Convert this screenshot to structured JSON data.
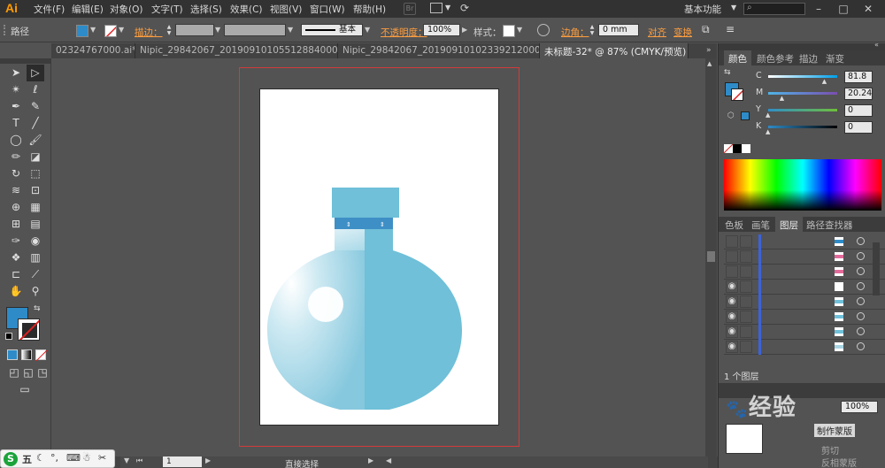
{
  "app": {
    "logo": "Ai"
  },
  "menu": {
    "items": [
      "文件(F)",
      "编辑(E)",
      "对象(O)",
      "文字(T)",
      "选择(S)",
      "效果(C)",
      "视图(V)",
      "窗口(W)",
      "帮助(H)"
    ],
    "br_label": "Br",
    "workspace": "基本功能"
  },
  "control": {
    "object_type": "路径",
    "stroke_label": "描边：",
    "stroke_style": "基本",
    "opacity_label": "不透明度：",
    "opacity_value": "100%",
    "style_label": "样式：",
    "corner_label": "边角：",
    "corner_value": "0 mm",
    "align_label": "对齐",
    "transform_label": "变换",
    "fill_color": "#2e8bc7"
  },
  "tabs": [
    {
      "label": "02324767000.ai*",
      "active": false
    },
    {
      "label": "Nipic_29842067_20190910105512884000.ai*",
      "active": false
    },
    {
      "label": "Nipic_29842067_20190910102339212000.ai*",
      "active": false
    },
    {
      "label": "未标题-32* @ 87% (CMYK/预览)",
      "active": true
    }
  ],
  "color_panel": {
    "tabs": [
      "颜色",
      "颜色参考",
      "描边",
      "渐变"
    ],
    "channels": [
      {
        "letter": "C",
        "value": "81.8",
        "percent": 81.8,
        "gradient": "linear-gradient(to right,#ffffff,#00a0e9)"
      },
      {
        "letter": "M",
        "value": "20.24",
        "percent": 20.24,
        "gradient": "linear-gradient(to right,#4fb3e6,#7a4fb0)"
      },
      {
        "letter": "Y",
        "value": "0",
        "percent": 0,
        "gradient": "linear-gradient(to right,#2f8fc8,#6fbf3b)"
      },
      {
        "letter": "K",
        "value": "0",
        "percent": 0,
        "gradient": "linear-gradient(to right,#2e8bc7,#000000)"
      }
    ],
    "swatch_color": "#2e8bc7"
  },
  "layers_panel": {
    "tabs": [
      "色板",
      "画笔",
      "图层",
      "路径查找器"
    ],
    "active_tab": "图层",
    "footer": "1 个图层",
    "rows": [
      {
        "visible": false,
        "thumb": "#2e8bc7"
      },
      {
        "visible": false,
        "thumb": "#e26a9a"
      },
      {
        "visible": false,
        "thumb": "#e26a9a"
      },
      {
        "visible": true,
        "thumb": "#ffffff"
      },
      {
        "visible": true,
        "thumb": "#6fc0d8"
      },
      {
        "visible": true,
        "thumb": "#6fc0d8"
      },
      {
        "visible": true,
        "thumb": "#6fc0d8"
      },
      {
        "visible": true,
        "thumb": "#a8d4e3"
      }
    ]
  },
  "transparency": {
    "value": "100%",
    "mask_label": "制作蒙版",
    "clip_label": "剪切",
    "invert_label": "反相蒙版"
  },
  "status": {
    "zoom": "87%",
    "page": "1",
    "tool_name": "直接选择"
  },
  "ime": {
    "lang": "五"
  },
  "watermark": "经验"
}
